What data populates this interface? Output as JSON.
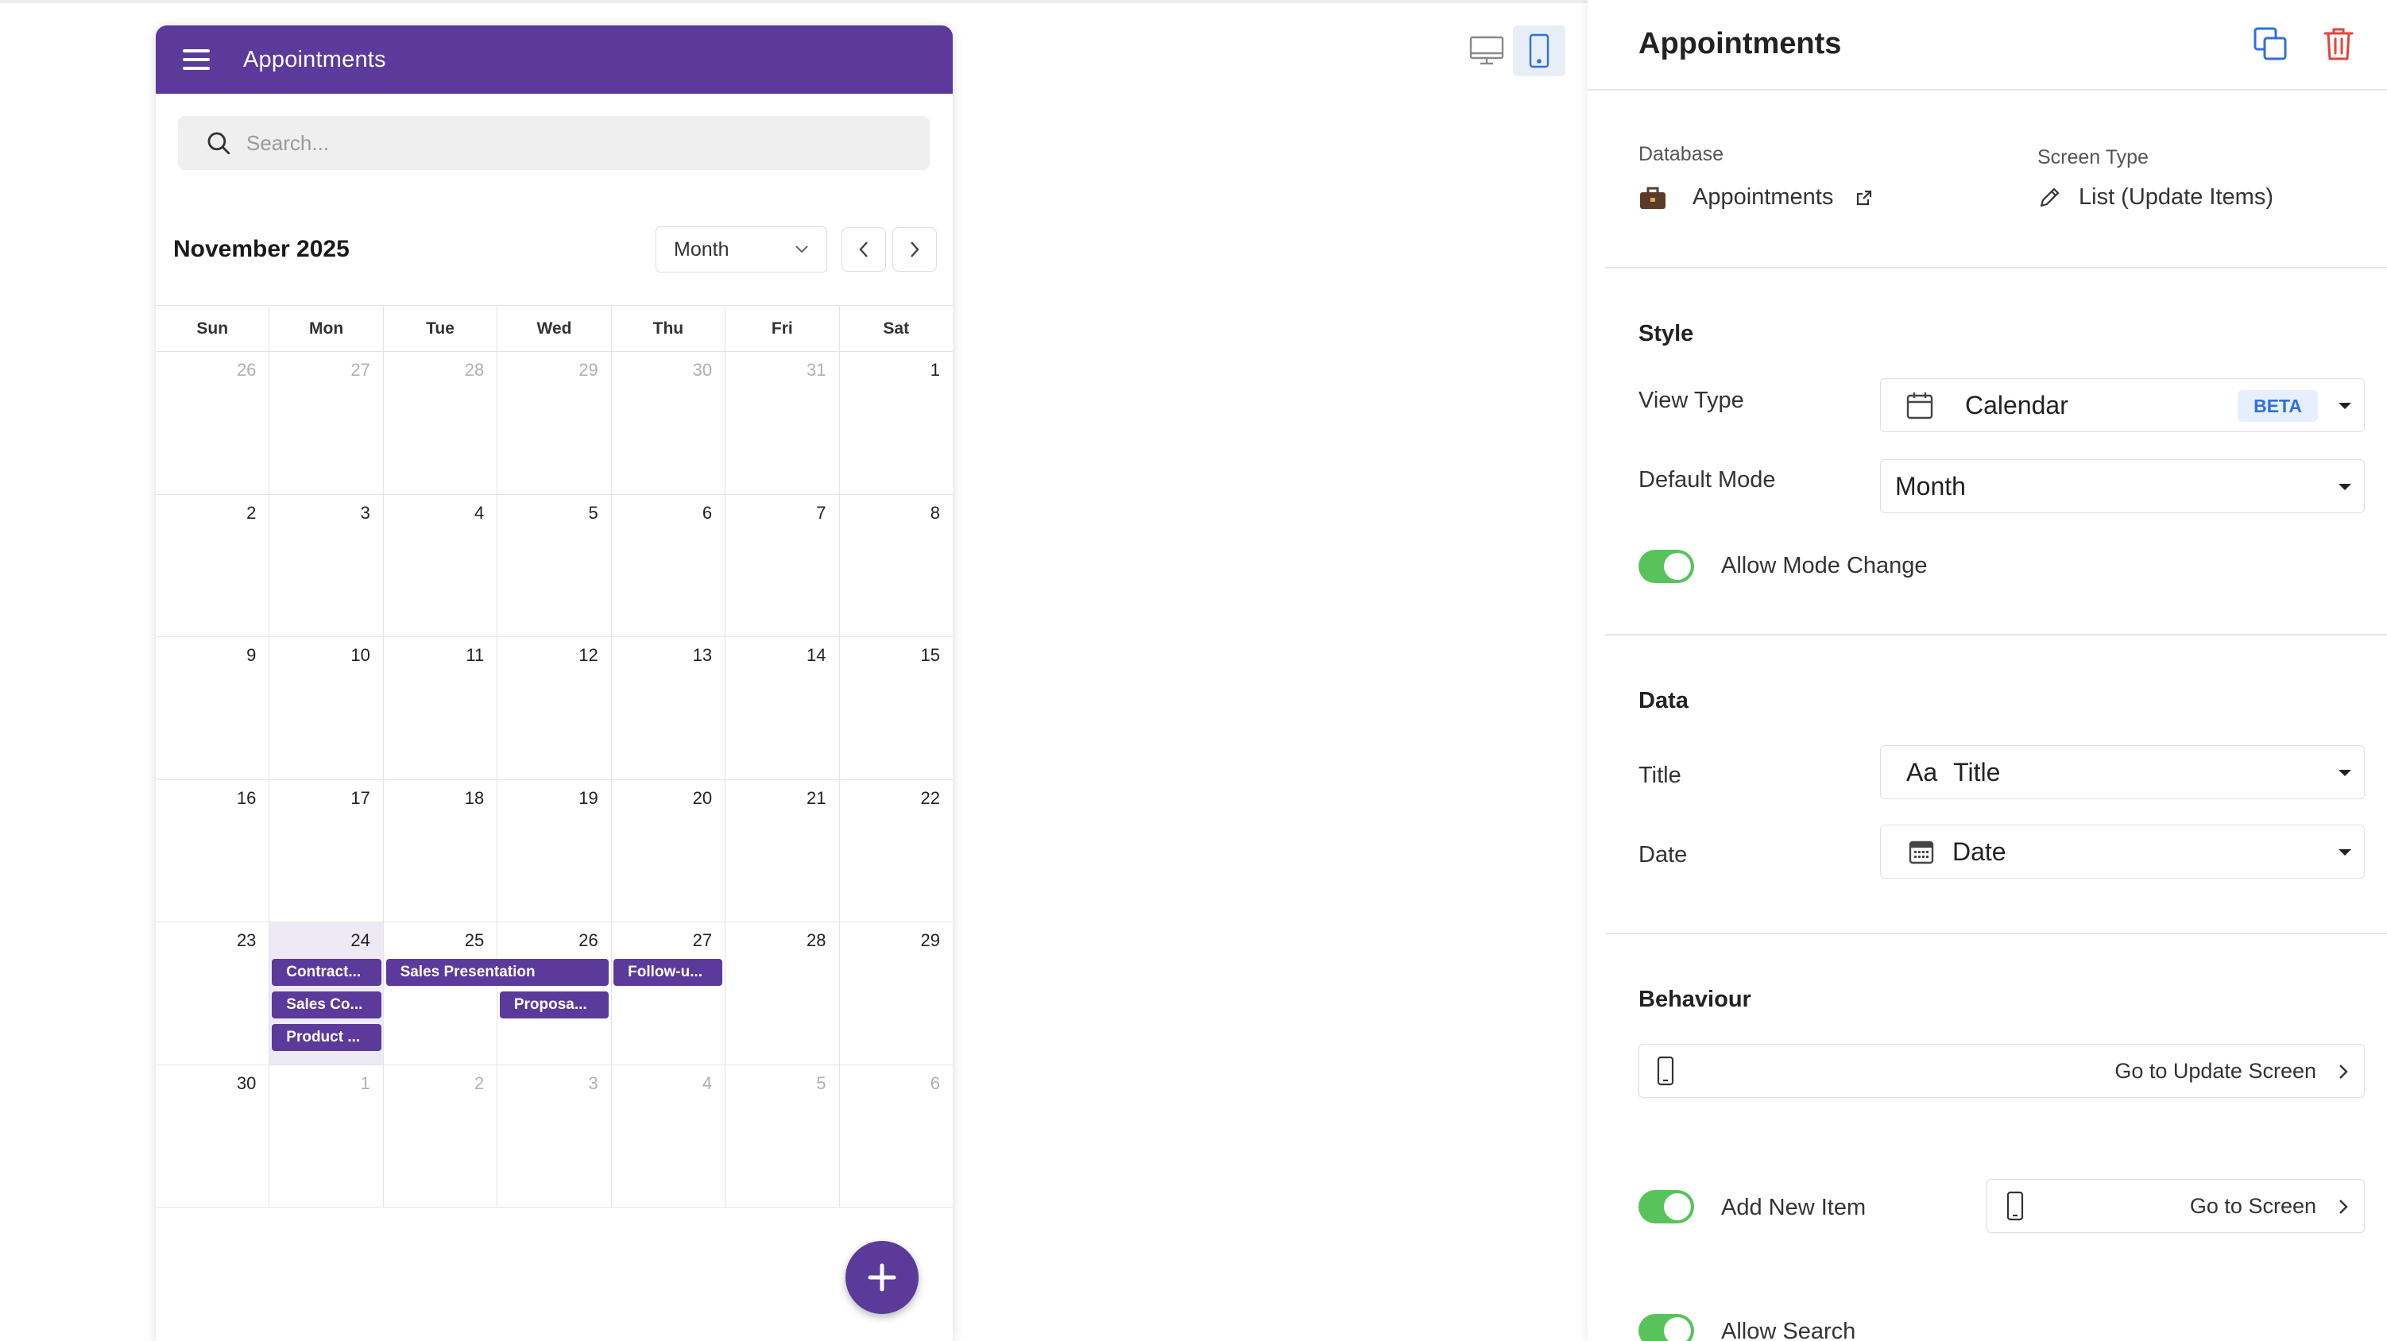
{
  "app": {
    "title": "Appointments",
    "search_placeholder": "Search..."
  },
  "calendar": {
    "month_label": "November 2025",
    "mode": "Month",
    "weekdays": [
      "Sun",
      "Mon",
      "Tue",
      "Wed",
      "Thu",
      "Fri",
      "Sat"
    ],
    "weeks": [
      [
        {
          "d": "26",
          "o": true
        },
        {
          "d": "27",
          "o": true
        },
        {
          "d": "28",
          "o": true
        },
        {
          "d": "29",
          "o": true
        },
        {
          "d": "30",
          "o": true
        },
        {
          "d": "31",
          "o": true
        },
        {
          "d": "1"
        }
      ],
      [
        {
          "d": "2"
        },
        {
          "d": "3"
        },
        {
          "d": "4"
        },
        {
          "d": "5"
        },
        {
          "d": "6"
        },
        {
          "d": "7"
        },
        {
          "d": "8"
        }
      ],
      [
        {
          "d": "9"
        },
        {
          "d": "10"
        },
        {
          "d": "11"
        },
        {
          "d": "12"
        },
        {
          "d": "13"
        },
        {
          "d": "14"
        },
        {
          "d": "15"
        }
      ],
      [
        {
          "d": "16"
        },
        {
          "d": "17"
        },
        {
          "d": "18"
        },
        {
          "d": "19"
        },
        {
          "d": "20"
        },
        {
          "d": "21"
        },
        {
          "d": "22"
        }
      ],
      [
        {
          "d": "23"
        },
        {
          "d": "24",
          "today": true
        },
        {
          "d": "25"
        },
        {
          "d": "26"
        },
        {
          "d": "27"
        },
        {
          "d": "28"
        },
        {
          "d": "29"
        }
      ],
      [
        {
          "d": "30"
        },
        {
          "d": "1",
          "o": true
        },
        {
          "d": "2",
          "o": true
        },
        {
          "d": "3",
          "o": true
        },
        {
          "d": "4",
          "o": true
        },
        {
          "d": "5",
          "o": true
        },
        {
          "d": "6",
          "o": true
        }
      ]
    ],
    "events": [
      {
        "label": "Contract...",
        "week": 4,
        "col": 1,
        "span": 1,
        "row": 0
      },
      {
        "label": "Sales Co...",
        "week": 4,
        "col": 1,
        "span": 1,
        "row": 1
      },
      {
        "label": "Product ...",
        "week": 4,
        "col": 1,
        "span": 1,
        "row": 2
      },
      {
        "label": "Sales Presentation",
        "week": 4,
        "col": 2,
        "span": 2,
        "row": 0
      },
      {
        "label": "Proposa...",
        "week": 4,
        "col": 3,
        "span": 1,
        "row": 1
      },
      {
        "label": "Follow-u...",
        "week": 4,
        "col": 4,
        "span": 1,
        "row": 0
      }
    ]
  },
  "panel": {
    "title": "Appointments",
    "database_label": "Database",
    "database_value": "Appointments",
    "screen_type_label": "Screen Type",
    "screen_type_value": "List (Update Items)",
    "style_title": "Style",
    "view_type_label": "View Type",
    "view_type_value": "Calendar",
    "view_type_badge": "BETA",
    "default_mode_label": "Default Mode",
    "default_mode_value": "Month",
    "allow_mode_change_label": "Allow Mode Change",
    "data_title": "Data",
    "title_label": "Title",
    "title_prefix": "Aa",
    "title_value": "Title",
    "date_label": "Date",
    "date_value": "Date",
    "behaviour_title": "Behaviour",
    "behaviour_action": "Go to Update Screen",
    "add_new_item_label": "Add New Item",
    "add_new_item_action": "Go to Screen",
    "allow_search_label": "Allow Search"
  },
  "colors": {
    "primary_purple": "#5b3a9b",
    "toggle_green": "#58c35a",
    "accent_blue": "#2f6fe0",
    "danger_red": "#e0453e"
  }
}
